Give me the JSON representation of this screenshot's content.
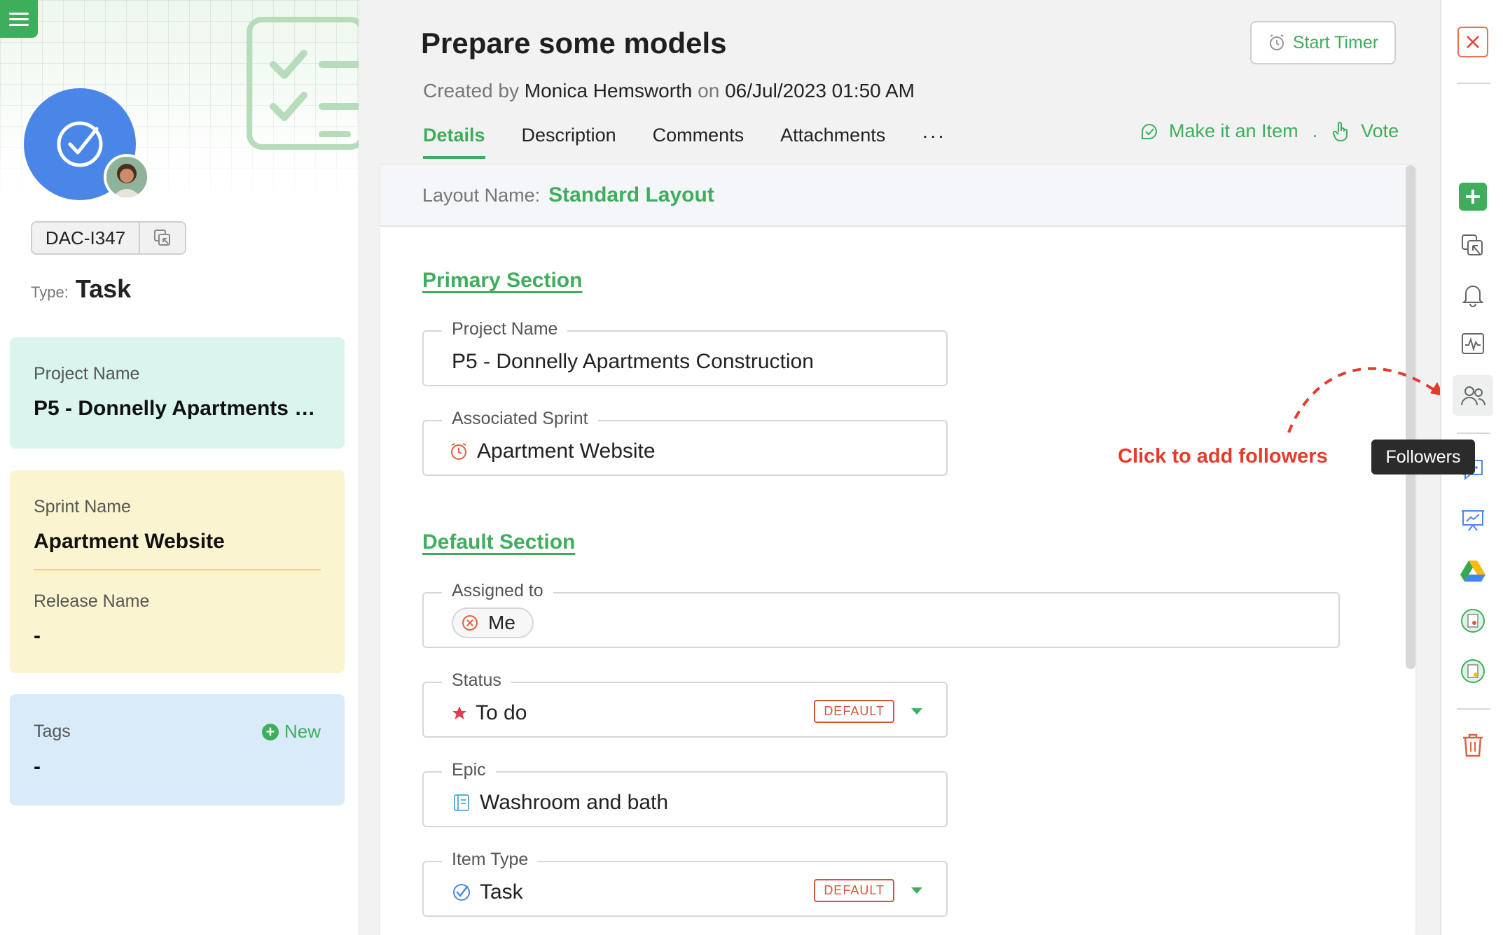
{
  "left": {
    "item_id": "DAC-I347",
    "type_label": "Type:",
    "type_value": "Task",
    "project": {
      "label": "Project Name",
      "value": "P5 - Donnelly Apartments C..."
    },
    "sprint": {
      "label": "Sprint Name",
      "value": "Apartment Website"
    },
    "release": {
      "label": "Release Name",
      "value": "-"
    },
    "tags": {
      "label": "Tags",
      "new_label": "New",
      "value": "-"
    }
  },
  "header": {
    "title": "Prepare some models",
    "created_prefix": "Created by",
    "created_by": "Monica Hemsworth",
    "created_on_word": "on",
    "created_date": "06/Jul/2023 01:50 AM",
    "timer_label": "Start Timer",
    "make_item_label": "Make it an Item",
    "separator": ".",
    "vote_label": "Vote"
  },
  "tabs": [
    {
      "label": "Details",
      "active": true
    },
    {
      "label": "Description"
    },
    {
      "label": "Comments"
    },
    {
      "label": "Attachments"
    }
  ],
  "tabs_more": "···",
  "layout": {
    "label": "Layout Name:",
    "value": "Standard Layout"
  },
  "sections": {
    "primary": "Primary Section",
    "default": "Default Section"
  },
  "fields": {
    "project_name": {
      "label": "Project Name",
      "value": "P5 - Donnelly Apartments Construction"
    },
    "associated_sprint": {
      "label": "Associated Sprint",
      "value": "Apartment Website"
    },
    "assigned_to": {
      "label": "Assigned to",
      "value": "Me"
    },
    "status": {
      "label": "Status",
      "value": "To do",
      "badge": "DEFAULT"
    },
    "epic": {
      "label": "Epic",
      "value": "Washroom and bath"
    },
    "item_type": {
      "label": "Item Type",
      "value": "Task",
      "badge": "DEFAULT"
    }
  },
  "annotation": "Click to add followers",
  "tooltip": "Followers",
  "rail_icons": [
    "close-icon",
    "add-icon",
    "copy-link-icon",
    "bell-icon",
    "activity-icon",
    "followers-icon",
    "chat-icon",
    "presentation-icon",
    "google-drive-icon",
    "document-user-icon",
    "document-badge-icon",
    "trash-icon"
  ],
  "colors": {
    "brand_green": "#3fae5c",
    "accent_red": "#e53b2c",
    "avatar_blue": "#4a86e8"
  }
}
